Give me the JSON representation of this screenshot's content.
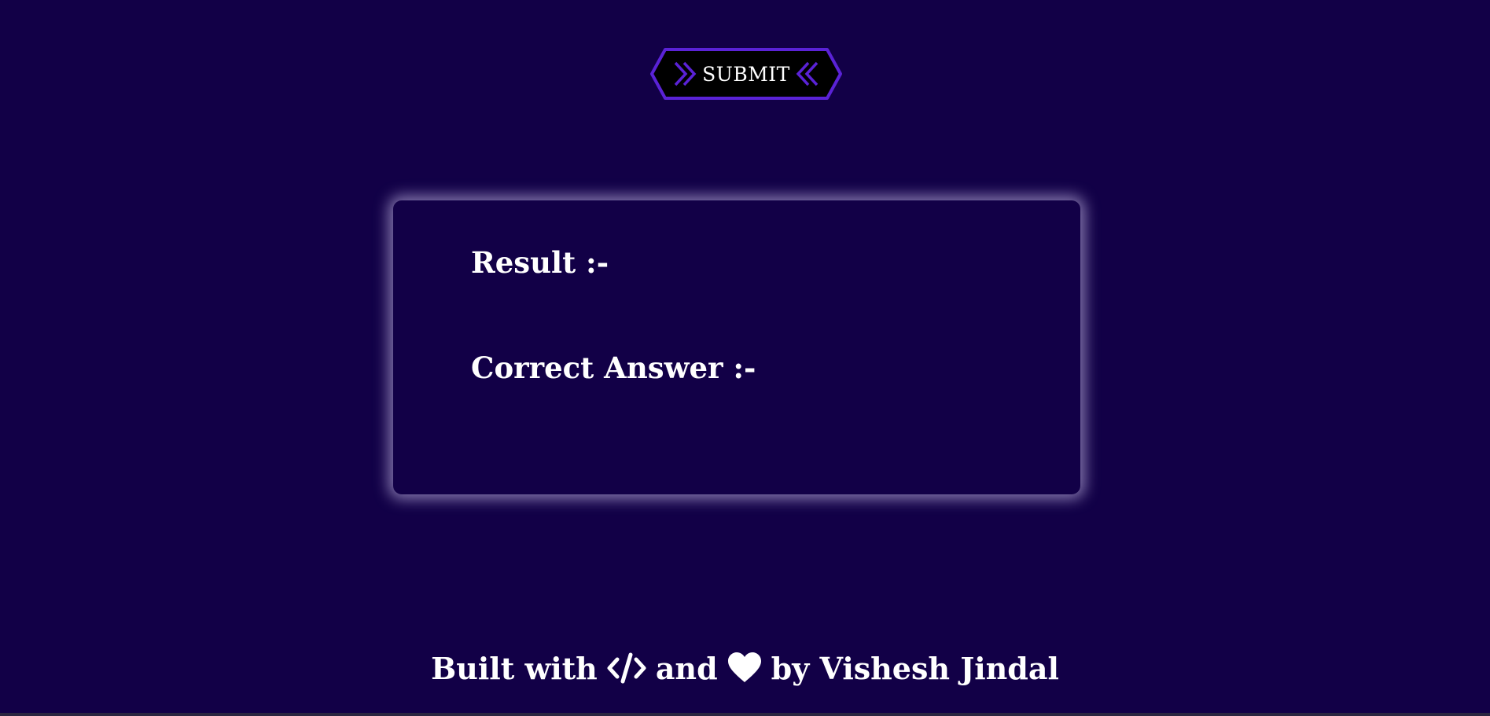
{
  "theme": {
    "background": "#120047",
    "accent": "#5a22d6",
    "text": "#ffffff",
    "card_glow": "#e1d7ff"
  },
  "submit_button": {
    "label": "SUBMIT",
    "left_icon": "double-chevron-right-icon",
    "right_icon": "double-chevron-left-icon"
  },
  "result_card": {
    "result_label": "Result :-",
    "correct_answer_label": "Correct Answer :-"
  },
  "footer": {
    "prefix": "Built with",
    "code_icon": "code-icon",
    "middle": "and",
    "heart_icon": "heart-icon",
    "suffix": "by Vishesh Jindal"
  }
}
